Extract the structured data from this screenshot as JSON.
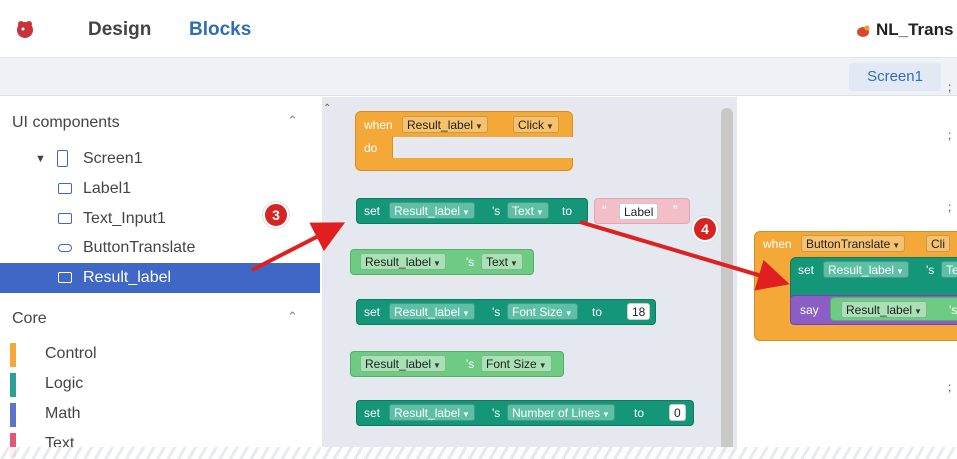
{
  "topbar": {
    "tab_design": "Design",
    "tab_blocks": "Blocks",
    "project_name": "NL_Trans",
    "screen_button": "Screen1"
  },
  "left": {
    "ui_components_title": "UI components",
    "tree": [
      {
        "label": "Screen1"
      },
      {
        "label": "Label1"
      },
      {
        "label": "Text_Input1"
      },
      {
        "label": "ButtonTranslate"
      },
      {
        "label": "Result_label"
      }
    ],
    "core_title": "Core",
    "core_items": [
      {
        "label": "Control",
        "color": "#f3a838"
      },
      {
        "label": "Logic",
        "color": "#2aa198"
      },
      {
        "label": "Math",
        "color": "#5a74c7"
      },
      {
        "label": "Text",
        "color": "#e05873"
      }
    ]
  },
  "drawer": {
    "event_block": {
      "when": "when",
      "component": "Result_label",
      "event": "Click",
      "do": "do"
    },
    "set_text": {
      "set": "set",
      "component": "Result_label",
      "s": "'s",
      "prop": "Text",
      "to": "to",
      "string": "Label",
      "open_quote": "“",
      "close_quote": "”"
    },
    "get_text": {
      "component": "Result_label",
      "s": "'s",
      "prop": "Text"
    },
    "set_fontsize": {
      "set": "set",
      "component": "Result_label",
      "s": "'s",
      "prop": "Font Size",
      "to": "to",
      "value": "18"
    },
    "get_fontsize": {
      "component": "Result_label",
      "s": "'s",
      "prop": "Font Size"
    },
    "set_lines": {
      "set": "set",
      "component": "Result_label",
      "s": "'s",
      "prop": "Number of Lines",
      "to": "to",
      "value": "0"
    }
  },
  "workspace": {
    "when": "when",
    "component": "ButtonTranslate",
    "event": "Cli",
    "set": "set",
    "set_component": "Result_label",
    "s": "'s",
    "set_prop": "Te",
    "say": "say",
    "say_component": "Result_label",
    "say_s": "'s"
  },
  "callouts": {
    "three": "3",
    "four": "4"
  },
  "colors": {
    "accent": "#2f6eb5",
    "selection": "#3f67c6",
    "arrow": "#e02020"
  }
}
